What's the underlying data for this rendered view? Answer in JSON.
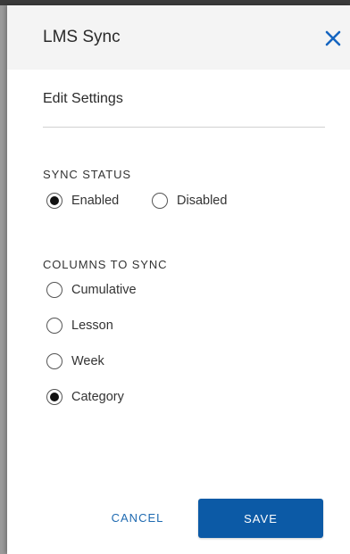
{
  "panel": {
    "title": "LMS Sync",
    "subtitle": "Edit Settings",
    "close_icon": "close-icon",
    "accent_color": "#0c5aa6"
  },
  "sync_status": {
    "label": "SYNC STATUS",
    "options": [
      {
        "label": "Enabled",
        "checked": true
      },
      {
        "label": "Disabled",
        "checked": false
      }
    ]
  },
  "columns": {
    "label": "COLUMNS TO SYNC",
    "options": [
      {
        "label": "Cumulative",
        "checked": false
      },
      {
        "label": "Lesson",
        "checked": false
      },
      {
        "label": "Week",
        "checked": false
      },
      {
        "label": "Category",
        "checked": true
      }
    ]
  },
  "footer": {
    "cancel_label": "CANCEL",
    "save_label": "SAVE"
  }
}
